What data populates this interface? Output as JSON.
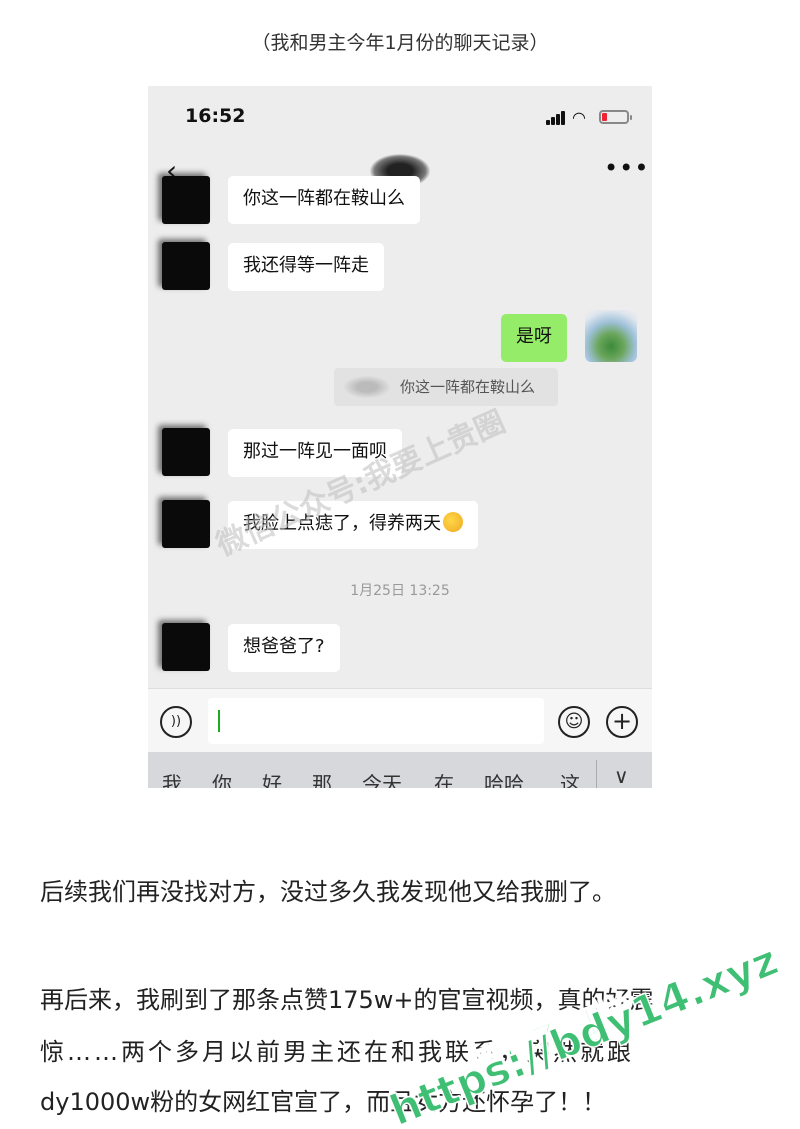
{
  "caption": "（我和男主今年1月份的聊天记录）",
  "status": {
    "time": "16:52"
  },
  "chat": {
    "messages": [
      {
        "side": "left",
        "text": "你这一阵都在鞍山么"
      },
      {
        "side": "left",
        "text": "我还得等一阵走"
      },
      {
        "side": "right",
        "text": "是呀"
      },
      {
        "side": "quote",
        "text": "你这一阵都在鞍山么"
      },
      {
        "side": "left",
        "text": "那过一阵见一面呗"
      },
      {
        "side": "left",
        "text": "我脸上点痣了，得养两天"
      },
      {
        "side": "time",
        "text": "1月25日 13:25"
      },
      {
        "side": "left",
        "text": "想爸爸了?"
      }
    ],
    "watermark": "微信公众号:我要上贵圈"
  },
  "icons": {
    "back": "chevron-left-icon",
    "more": "more-icon",
    "voice": "voice-icon",
    "emoji": "emoji-icon",
    "plus": "plus-icon"
  },
  "keyboard": {
    "suggestions": [
      "我",
      "你",
      "好",
      "那",
      "今天",
      "在",
      "哈哈",
      "这"
    ]
  },
  "paragraphs": [
    "后续我们再没找对方，没过多久我发现他又给我删了。",
    "再后来，我刷到了那条点赞175w+的官宣视频，真的好震",
    "惊……两个多月以前男主还在和我联系，突然就跟",
    "dy1000w粉的女网红官宣了，而且女方还怀孕了！！"
  ],
  "watermark2": {
    "line1": "黑料不打烊",
    "line2": "https://bdy14.xyz"
  }
}
